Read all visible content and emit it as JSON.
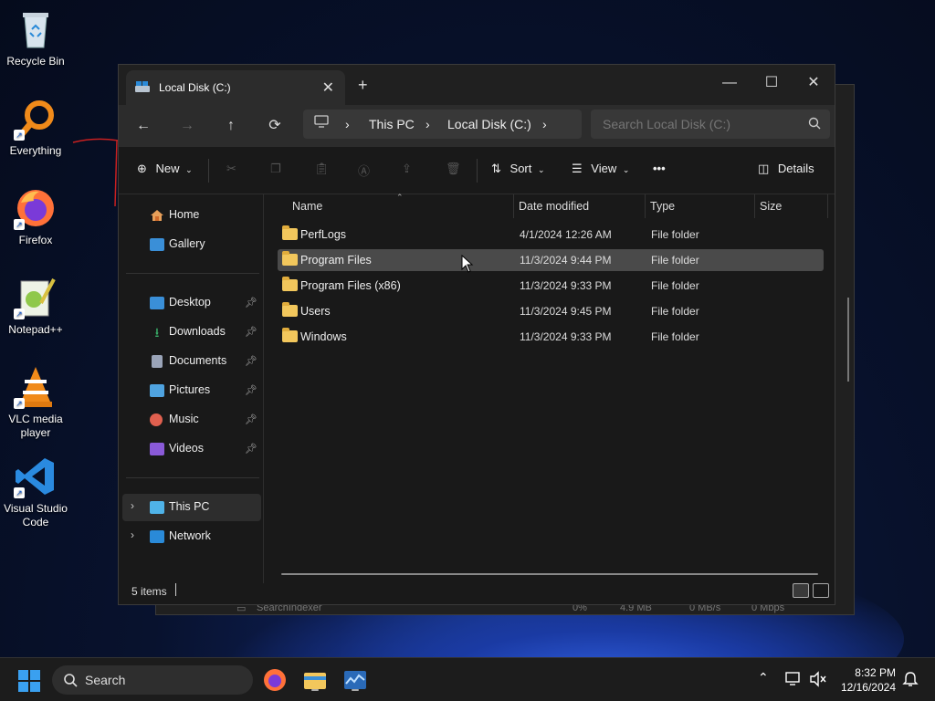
{
  "desktop": {
    "icons": [
      {
        "label": "Recycle Bin",
        "icon": "recycle-bin-icon"
      },
      {
        "label": "Everything",
        "icon": "everything-search-icon"
      },
      {
        "label": "Firefox",
        "icon": "firefox-icon"
      },
      {
        "label": "Notepad++",
        "icon": "notepad-plus-plus-icon"
      },
      {
        "label": "VLC media player",
        "icon": "vlc-icon"
      },
      {
        "label": "Visual Studio Code",
        "icon": "vscode-icon"
      }
    ]
  },
  "background_window": {
    "row": {
      "name": "SearchIndexer",
      "cpu": "0%",
      "memory": "4.9 MB",
      "disk": "0 MB/s",
      "network": "0 Mbps"
    }
  },
  "explorer": {
    "tab_title": "Local Disk (C:)",
    "new_tab": "+",
    "controls": {
      "minimize": "—",
      "maximize": "☐",
      "close": "✕"
    },
    "breadcrumb": [
      "This PC",
      "Local Disk (C:)"
    ],
    "search_placeholder": "Search Local Disk (C:)",
    "toolbar": {
      "new": "New",
      "sort": "Sort",
      "view": "View",
      "more": "•••",
      "details": "Details"
    },
    "nav": {
      "home": "Home",
      "gallery": "Gallery",
      "quick": [
        {
          "label": "Desktop",
          "color": "#3a8fd8"
        },
        {
          "label": "Downloads",
          "color": "#3ab06a"
        },
        {
          "label": "Documents",
          "color": "#9aa4b8"
        },
        {
          "label": "Pictures",
          "color": "#4fa3e0"
        },
        {
          "label": "Music",
          "color": "#e0604f"
        },
        {
          "label": "Videos",
          "color": "#8a5ad8"
        }
      ],
      "this_pc": "This PC",
      "network": "Network"
    },
    "columns": {
      "name": "Name",
      "date": "Date modified",
      "type": "Type",
      "size": "Size"
    },
    "files": [
      {
        "name": "PerfLogs",
        "date": "4/1/2024 12:26 AM",
        "type": "File folder"
      },
      {
        "name": "Program Files",
        "date": "11/3/2024 9:44 PM",
        "type": "File folder"
      },
      {
        "name": "Program Files (x86)",
        "date": "11/3/2024 9:33 PM",
        "type": "File folder"
      },
      {
        "name": "Users",
        "date": "11/3/2024 9:45 PM",
        "type": "File folder"
      },
      {
        "name": "Windows",
        "date": "11/3/2024 9:33 PM",
        "type": "File folder"
      }
    ],
    "status": "5 items"
  },
  "taskbar": {
    "search_label": "Search",
    "time": "8:32 PM",
    "date": "12/16/2024"
  }
}
